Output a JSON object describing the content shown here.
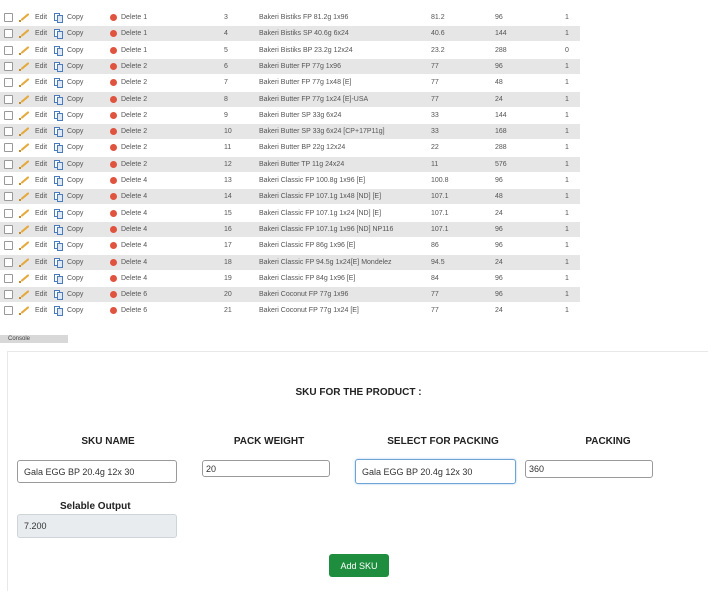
{
  "table": {
    "actions": {
      "edit": "Edit",
      "copy": "Copy",
      "delete": "Delete"
    },
    "rows": [
      {
        "fk": "1",
        "id": "3",
        "product": "Bakeri Bistiks FP 81.2g 1x96",
        "weight": "81.2",
        "qty": "96",
        "flag": "1"
      },
      {
        "fk": "1",
        "id": "4",
        "product": "Bakeri Bistiks SP 40.6g 6x24",
        "weight": "40.6",
        "qty": "144",
        "flag": "1"
      },
      {
        "fk": "1",
        "id": "5",
        "product": "Bakeri Bistiks BP 23.2g 12x24",
        "weight": "23.2",
        "qty": "288",
        "flag": "0"
      },
      {
        "fk": "2",
        "id": "6",
        "product": "Bakeri Butter FP 77g 1x96",
        "weight": "77",
        "qty": "96",
        "flag": "1"
      },
      {
        "fk": "2",
        "id": "7",
        "product": "Bakeri Butter FP 77g 1x48 [E]",
        "weight": "77",
        "qty": "48",
        "flag": "1"
      },
      {
        "fk": "2",
        "id": "8",
        "product": "Bakeri Butter FP 77g 1x24 [E]-USA",
        "weight": "77",
        "qty": "24",
        "flag": "1"
      },
      {
        "fk": "2",
        "id": "9",
        "product": "Bakeri Butter SP 33g 6x24",
        "weight": "33",
        "qty": "144",
        "flag": "1"
      },
      {
        "fk": "2",
        "id": "10",
        "product": "Bakeri Butter SP 33g 6x24 [CP+17P11g]",
        "weight": "33",
        "qty": "168",
        "flag": "1"
      },
      {
        "fk": "2",
        "id": "11",
        "product": "Bakeri Butter BP 22g 12x24",
        "weight": "22",
        "qty": "288",
        "flag": "1"
      },
      {
        "fk": "2",
        "id": "12",
        "product": "Bakeri Butter TP 11g 24x24",
        "weight": "11",
        "qty": "576",
        "flag": "1"
      },
      {
        "fk": "4",
        "id": "13",
        "product": "Bakeri Classic FP 100.8g 1x96 [E]",
        "weight": "100.8",
        "qty": "96",
        "flag": "1"
      },
      {
        "fk": "4",
        "id": "14",
        "product": "Bakeri Classic FP 107.1g 1x48 [ND] [E]",
        "weight": "107.1",
        "qty": "48",
        "flag": "1"
      },
      {
        "fk": "4",
        "id": "15",
        "product": "Bakeri Classic FP 107.1g 1x24 [ND] [E]",
        "weight": "107.1",
        "qty": "24",
        "flag": "1"
      },
      {
        "fk": "4",
        "id": "16",
        "product": "Bakeri Classic FP 107.1g 1x96 [ND] NP116",
        "weight": "107.1",
        "qty": "96",
        "flag": "1"
      },
      {
        "fk": "4",
        "id": "17",
        "product": "Bakeri Classic FP 86g 1x96 [E]",
        "weight": "86",
        "qty": "96",
        "flag": "1"
      },
      {
        "fk": "4",
        "id": "18",
        "product": "Bakeri Classic FP 94.5g 1x24[E] Mondelez",
        "weight": "94.5",
        "qty": "24",
        "flag": "1"
      },
      {
        "fk": "4",
        "id": "19",
        "product": "Bakeri Classic FP 84g 1x96 [E]",
        "weight": "84",
        "qty": "96",
        "flag": "1"
      },
      {
        "fk": "6",
        "id": "20",
        "product": "Bakeri Coconut FP 77g 1x96",
        "weight": "77",
        "qty": "96",
        "flag": "1"
      },
      {
        "fk": "6",
        "id": "21",
        "product": "Bakeri Coconut FP 77g 1x24 [E]",
        "weight": "77",
        "qty": "24",
        "flag": "1"
      }
    ],
    "console_label": "Console"
  },
  "form": {
    "title": "SKU FOR THE PRODUCT :",
    "headers": {
      "sku_name": "SKU NAME",
      "pack_weight": "PACK WEIGHT",
      "select_packing": "SELECT FOR PACKING",
      "packing": "PACKING"
    },
    "values": {
      "sku_name": "Gala EGG BP 20.4g 12x 30",
      "pack_weight": "20",
      "select_packing": "Gala EGG BP 20.4g 12x 30",
      "packing": "360"
    },
    "selable_label": "Selable Output",
    "selable_value": "7.200",
    "add_button": "Add SKU"
  },
  "colors": {
    "row_alt": "#e6e6e6",
    "add_button": "#1e8e3e",
    "delete_icon": "#e0533f",
    "edit_icon": "#e5a93c",
    "copy_icon": "#4a7bbd"
  }
}
